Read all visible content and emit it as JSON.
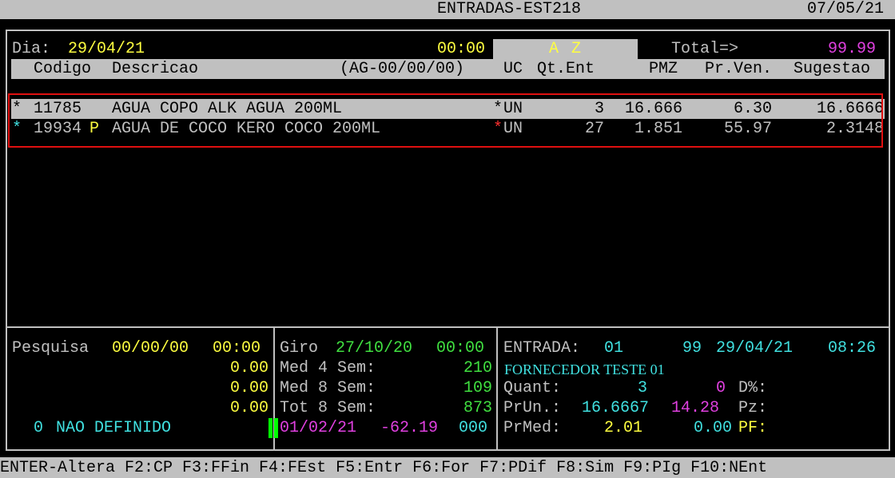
{
  "title_bar": {
    "title": "ENTRADAS-EST218",
    "date": "07/05/21"
  },
  "header": {
    "dia_label": "Dia:",
    "dia_value": "29/04/21",
    "time": "00:00",
    "sort_a": "A",
    "sort_z": "Z",
    "total_label": "Total=>",
    "total_value": "99.99"
  },
  "columns": {
    "codigo": "Codigo",
    "descricao": "Descricao",
    "ag": "(AG-00/00/00)",
    "uc": "UC",
    "qt_ent": "Qt.Ent",
    "pmz": "PMZ",
    "pr_ven": "Pr.Ven.",
    "sugestao": "Sugestao"
  },
  "rows": [
    {
      "mark": "*",
      "codigo": "11785",
      "flag": "",
      "descricao": "AGUA COPO ALK AGUA 200ML",
      "uc_mark": "*",
      "uc": "UN",
      "qt": "3",
      "pmz": "16.666",
      "prven": "6.30",
      "sugestao": "16.6666"
    },
    {
      "mark": "*",
      "codigo": "19934",
      "flag": "P",
      "descricao": "AGUA DE COCO KERO COCO 200ML",
      "uc_mark": "*",
      "uc": "UN",
      "qt": "27",
      "pmz": "1.851",
      "prven": "55.97",
      "sugestao": "2.3148"
    }
  ],
  "panel_left": {
    "pesquisa_label": "Pesquisa",
    "pesquisa_date": "00/00/00",
    "pesquisa_time": "00:00",
    "val1": "0.00",
    "val2": "0.00",
    "val3": "0.00",
    "nao_definido_num": "0",
    "nao_definido_label": "NAO DEFINIDO"
  },
  "panel_mid": {
    "giro_label": "Giro",
    "giro_date": "27/10/20",
    "giro_time": "00:00",
    "med4_label": "Med 4 Sem:",
    "med4_value": "210",
    "med8_label": "Med 8 Sem:",
    "med8_value": "109",
    "tot8_label": "Tot 8 Sem:",
    "tot8_value": "873",
    "last_date": "01/02/21",
    "last_value": "-62.19",
    "last_code": "000"
  },
  "panel_right": {
    "entrada_label": "ENTRADA:",
    "entrada_num": "01",
    "entrada_code": "99",
    "entrada_date": "29/04/21",
    "entrada_time": "08:26",
    "fornecedor": "FORNECEDOR TESTE 01",
    "quant_label": "Quant:",
    "quant_value": "3",
    "quant_zero": "0",
    "dperc_label": "D%:",
    "prun_label": "PrUn.:",
    "prun_value": "16.6667",
    "prun_pct": "14.28",
    "pz_label": "Pz:",
    "prmed_label": "PrMed:",
    "prmed_value": "2.01",
    "prmed_pf_value": "0.00",
    "pf_label": "PF:"
  },
  "function_keys": "ENTER-Altera F2:CP F3:FFin F4:FEst F5:Entr F6:For F7:PDif F8:Sim F9:PIg F10:NEnt",
  "colors": {
    "background": "#000000",
    "bar": "#c0c0c0",
    "yellow": "#ffff40",
    "cyan": "#40e0e0",
    "green": "#40e040",
    "magenta": "#e040e0",
    "red_highlight": "#e01010"
  }
}
